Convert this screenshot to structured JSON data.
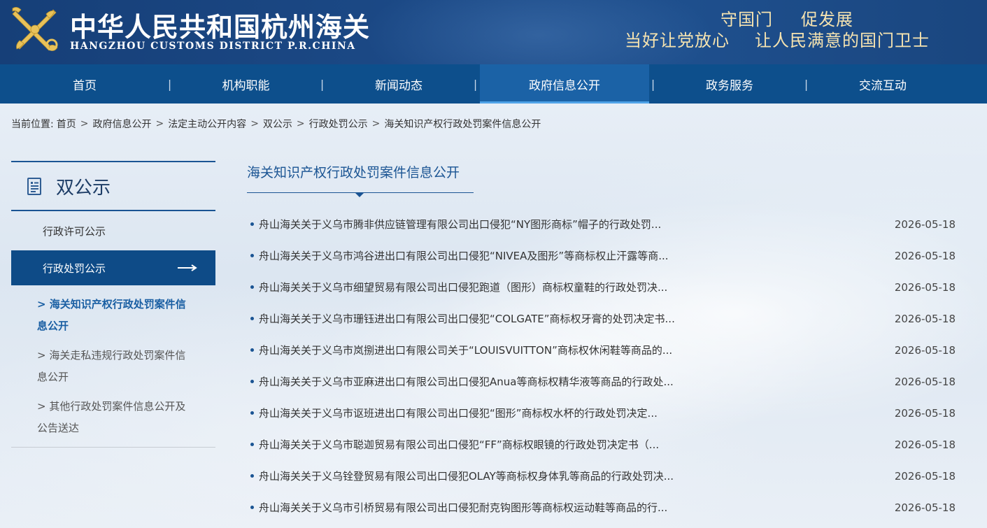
{
  "header": {
    "title": "中华人民共和国杭州海关",
    "subtitle": "HANGZHOU CUSTOMS DISTRICT P.R.CHINA",
    "slogan_line1_a": "守国门",
    "slogan_line1_b": "促发展",
    "slogan_line2_a": "当好让党放心",
    "slogan_line2_b": "让人民满意的国门卫士",
    "emblem_icon": "customs-emblem-icon"
  },
  "nav": {
    "items": [
      {
        "label": "首页"
      },
      {
        "label": "机构职能"
      },
      {
        "label": "新闻动态"
      },
      {
        "label": "政府信息公开",
        "active": true
      },
      {
        "label": "政务服务"
      },
      {
        "label": "交流互动"
      }
    ],
    "separator": "|"
  },
  "breadcrumb": {
    "lead": "当前位置:",
    "items": [
      "首页",
      "政府信息公开",
      "法定主动公开内容",
      "双公示",
      "行政处罚公示",
      "海关知识产权行政处罚案件信息公开"
    ],
    "separator": ">"
  },
  "sidebar": {
    "title": "双公示",
    "title_icon": "document-icon",
    "items": [
      {
        "label": "行政许可公示"
      },
      {
        "label": "行政处罚公示",
        "active": true,
        "icon": "arrow-right-icon"
      }
    ],
    "sub_items": [
      {
        "label": "> 海关知识产权行政处罚案件信息公开",
        "active": true
      },
      {
        "label": "> 海关走私违规行政处罚案件信息公开"
      },
      {
        "label": "> 其他行政处罚案件信息公开及公告送达"
      }
    ]
  },
  "main": {
    "section_title": "海关知识产权行政处罚案件信息公开",
    "articles": [
      {
        "title": "舟山海关关于义乌市腾非供应链管理有限公司出口侵犯“NY图形商标”帽子的行政处罚...",
        "date": "2026-05-18"
      },
      {
        "title": "舟山海关关于义乌市鸿谷进出口有限公司出口侵犯“NIVEA及图形”等商标权止汗露等商...",
        "date": "2026-05-18"
      },
      {
        "title": "舟山海关关于义乌市细望贸易有限公司出口侵犯跑道（图形）商标权童鞋的行政处罚决...",
        "date": "2026-05-18"
      },
      {
        "title": "舟山海关关于义乌市珊钰进出口有限公司出口侵犯“COLGATE”商标权牙膏的处罚决定书...",
        "date": "2026-05-18"
      },
      {
        "title": "舟山海关关于义乌市岚捌进出口有限公司关于“LOUISVUITTON”商标权休闲鞋等商品的...",
        "date": "2026-05-18"
      },
      {
        "title": "舟山海关关于义乌市亚麻进出口有限公司出口侵犯Anua等商标权精华液等商品的行政处...",
        "date": "2026-05-18"
      },
      {
        "title": "舟山海关关于义乌市讴班进出口有限公司出口侵犯“图形”商标权水杯的行政处罚决定...",
        "date": "2026-05-18"
      },
      {
        "title": "舟山海关关于义乌市聪迦贸易有限公司出口侵犯“FF”商标权眼镜的行政处罚决定书（...",
        "date": "2026-05-18"
      },
      {
        "title": "舟山海关关于义乌铨登贸易有限公司出口侵犯OLAY等商标权身体乳等商品的行政处罚决...",
        "date": "2026-05-18"
      },
      {
        "title": "舟山海关关于义乌市引桥贸易有限公司出口侵犯耐克钩图形等商标权运动鞋等商品的行...",
        "date": "2026-05-18"
      }
    ]
  },
  "colors": {
    "header_bg": "#1c4a87",
    "nav_bg": "#0d4f8c",
    "nav_active": "#1b62a6",
    "slogan": "#f5e3b0",
    "accent": "#1a5493"
  }
}
